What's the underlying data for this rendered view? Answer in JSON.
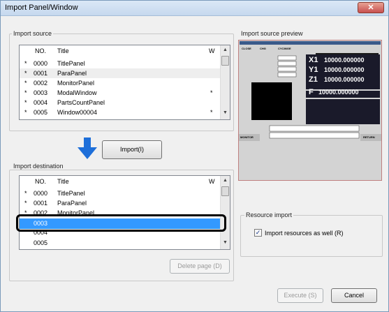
{
  "window": {
    "title": "Import Panel/Window",
    "close_glyph": "✕"
  },
  "import_source": {
    "label": "Import source",
    "columns": [
      "NO.",
      "Title",
      "W"
    ],
    "rows": [
      {
        "star": "*",
        "no": "0000",
        "title": "TitlePanel",
        "w": ""
      },
      {
        "star": "*",
        "no": "0001",
        "title": "ParaPanel",
        "w": ""
      },
      {
        "star": "*",
        "no": "0002",
        "title": "MonitorPanel",
        "w": ""
      },
      {
        "star": "*",
        "no": "0003",
        "title": "ModalWindow",
        "w": "*"
      },
      {
        "star": "*",
        "no": "0004",
        "title": "PartsCountPanel",
        "w": ""
      },
      {
        "star": "*",
        "no": "0005",
        "title": "Window00004",
        "w": "*"
      }
    ]
  },
  "import_button": {
    "label": "Import(I)"
  },
  "import_destination": {
    "label": "Import destination",
    "columns": [
      "NO.",
      "Title",
      "W"
    ],
    "rows": [
      {
        "star": "*",
        "no": "0000",
        "title": "TitlePanel",
        "w": ""
      },
      {
        "star": "*",
        "no": "0001",
        "title": "ParaPanel",
        "w": ""
      },
      {
        "star": "*",
        "no": "0002",
        "title": "MonitorPanel",
        "w": ""
      },
      {
        "star": "",
        "no": "0003",
        "title": "",
        "w": ""
      },
      {
        "star": "",
        "no": "0004",
        "title": "",
        "w": ""
      },
      {
        "star": "",
        "no": "0005",
        "title": "",
        "w": ""
      }
    ]
  },
  "delete_button": {
    "label": "Delete page (D)"
  },
  "preview": {
    "label": "Import source preview",
    "mini_labels": [
      "CLOSE",
      "CHG",
      "CYCIMGE"
    ],
    "axes": [
      {
        "axis": "X1",
        "value": "10000.000000"
      },
      {
        "axis": "Y1",
        "value": "10000.000000"
      },
      {
        "axis": "Z1",
        "value": "10000.000000"
      }
    ],
    "feed": {
      "axis": "F",
      "value": "10000.000000"
    },
    "side_left": "MONITOR",
    "side_right": "RETURN"
  },
  "resource_import": {
    "label": "Resource import",
    "checkbox_label": "Import resources as well (R)",
    "checked": true,
    "check_glyph": "✓"
  },
  "execute_button": {
    "label": "Execute (S)"
  },
  "cancel_button": {
    "label": "Cancel"
  },
  "colors": {
    "selection": "#3399ff",
    "arrow": "#1e6fd9",
    "preview_bg": "#d3d3d3",
    "preview_frame": "#c08080"
  }
}
